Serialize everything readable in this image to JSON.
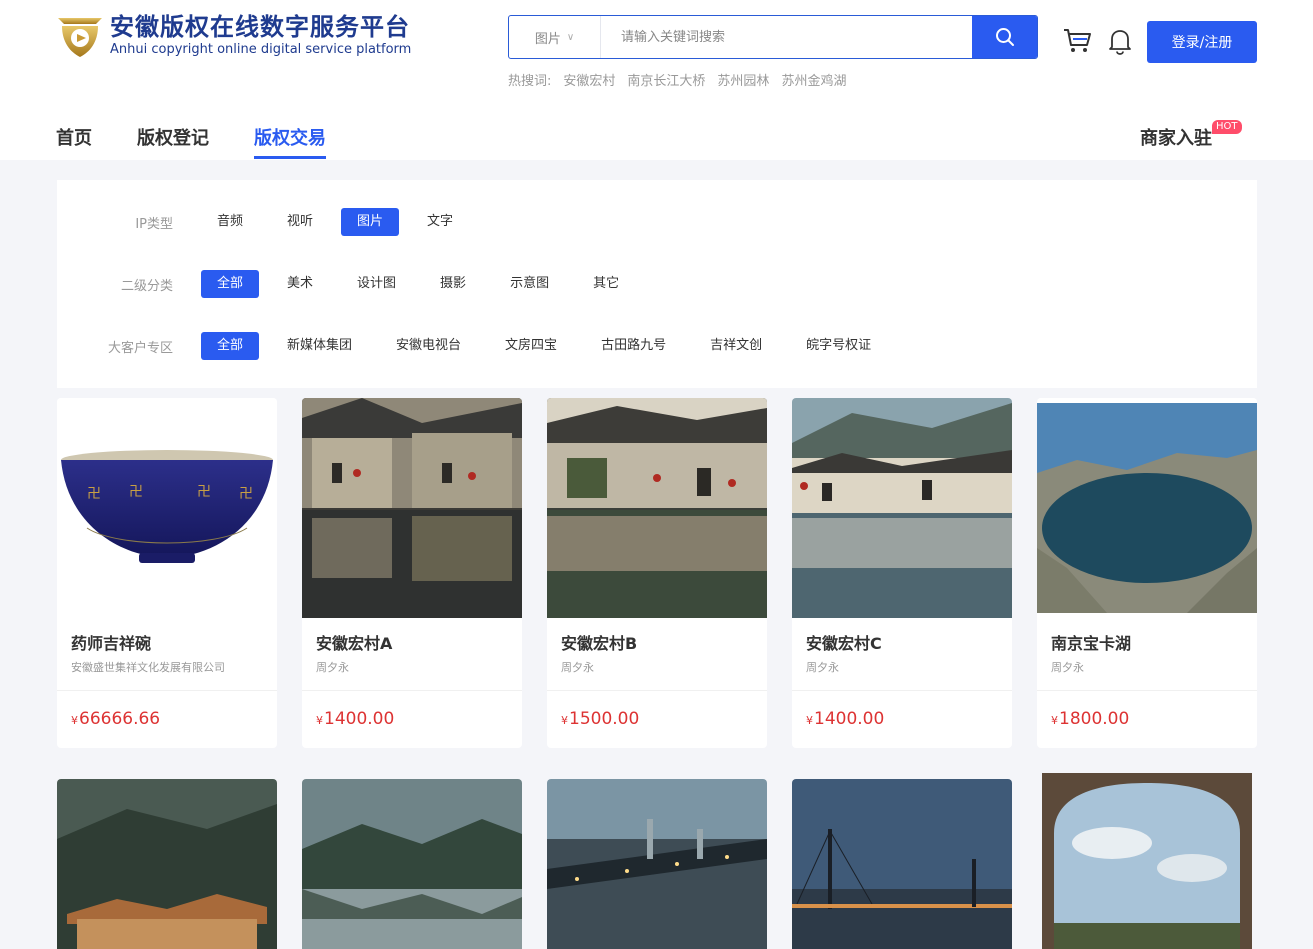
{
  "header": {
    "logo_cn": "安徽版权在线数字服务平台",
    "logo_en": "Anhui copyright online digital service platform",
    "search": {
      "type": "图片",
      "placeholder": "请输入关键词搜索"
    },
    "hot": {
      "label": "热搜词:",
      "terms": [
        "安徽宏村",
        "南京长江大桥",
        "苏州园林",
        "苏州金鸡湖"
      ]
    },
    "login_label": "登录/注册",
    "brand_color": "#2a5bf0"
  },
  "nav": {
    "items": [
      "首页",
      "版权登记",
      "版权交易"
    ],
    "active": "版权交易",
    "merchant": "商家入驻",
    "hot_badge": "HOT"
  },
  "filters": [
    {
      "label": "IP类型",
      "options": [
        "音频",
        "视听",
        "图片",
        "文字"
      ],
      "active": "图片"
    },
    {
      "label": "二级分类",
      "options": [
        "全部",
        "美术",
        "设计图",
        "摄影",
        "示意图",
        "其它"
      ],
      "active": "全部"
    },
    {
      "label": "大客户专区",
      "options": [
        "全部",
        "新媒体集团",
        "安徽电视台",
        "文房四宝",
        "古田路九号",
        "吉祥文创",
        "皖字号权证"
      ],
      "active": "全部"
    }
  ],
  "products": [
    {
      "title": "药师吉祥碗",
      "author": "安徽盛世集祥文化发展有限公司",
      "currency": "¥",
      "price": "66666.66",
      "image": "blue-porcelain-bowl"
    },
    {
      "title": "安徽宏村A",
      "author": "周夕永",
      "currency": "¥",
      "price": "1400.00",
      "image": "hongcun-village-reflection"
    },
    {
      "title": "安徽宏村B",
      "author": "周夕永",
      "currency": "¥",
      "price": "1500.00",
      "image": "hongcun-village-reflection"
    },
    {
      "title": "安徽宏村C",
      "author": "周夕永",
      "currency": "¥",
      "price": "1400.00",
      "image": "hongcun-village-reflection"
    },
    {
      "title": "南京宝卡湖",
      "author": "周夕永",
      "currency": "¥",
      "price": "1800.00",
      "image": "baoka-lake"
    }
  ],
  "products_row2": [
    {
      "image": "mountain-temple"
    },
    {
      "image": "misty-mountain-lake"
    },
    {
      "image": "yangtze-bridge-night"
    },
    {
      "image": "cable-stayed-bridge-dusk"
    },
    {
      "image": "stone-arch-view"
    }
  ]
}
